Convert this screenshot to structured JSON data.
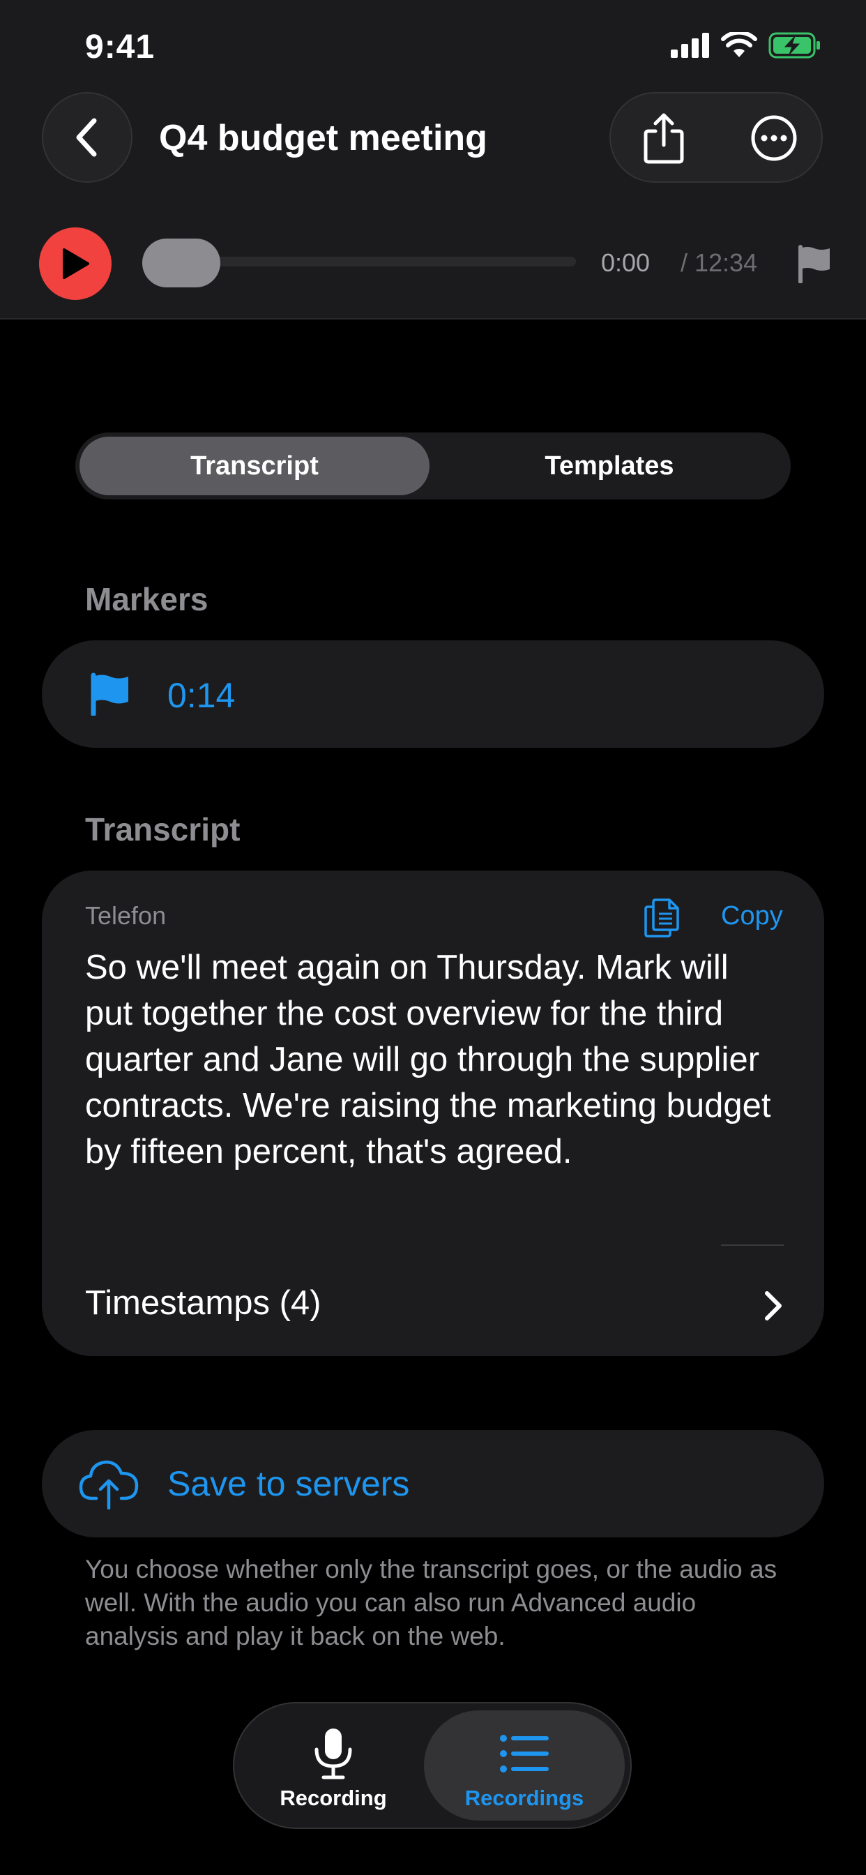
{
  "status_bar": {
    "time": "9:41"
  },
  "header": {
    "title": "Q4 budget meeting",
    "icons": {
      "back": "chevron-left-icon",
      "share": "share-icon",
      "more": "ellipsis-circle-icon"
    }
  },
  "player": {
    "current_time": "0:00",
    "total_time": "/ 12:34",
    "progress": 0,
    "play_color": "#f2423f"
  },
  "segmented": {
    "transcript": "Transcript",
    "templates": "Templates",
    "selected": "Transcript"
  },
  "markers": {
    "label": "Markers",
    "items": [
      {
        "time": "0:14",
        "icon": "flag-icon"
      }
    ]
  },
  "transcript": {
    "label": "Transcript",
    "speaker": "Telefon",
    "copy_label": "Copy",
    "text": "So we'll meet again on Thursday. Mark will put together the cost overview for the third quarter and Jane will go through the supplier contracts. We're raising the marketing budget by fifteen percent, that's agreed.",
    "timestamps_label": "Timestamps (4)"
  },
  "save": {
    "label": "Save to servers",
    "footnote": "You choose whether only the transcript goes, or the audio as well. With the audio you can also run Advanced audio analysis and play it back on the web."
  },
  "tabbar": {
    "recording": "Recording",
    "recordings": "Recordings",
    "selected": "Recordings"
  },
  "colors": {
    "accent": "#1e96f0",
    "background": "#000000",
    "card": "#1c1c1e"
  }
}
